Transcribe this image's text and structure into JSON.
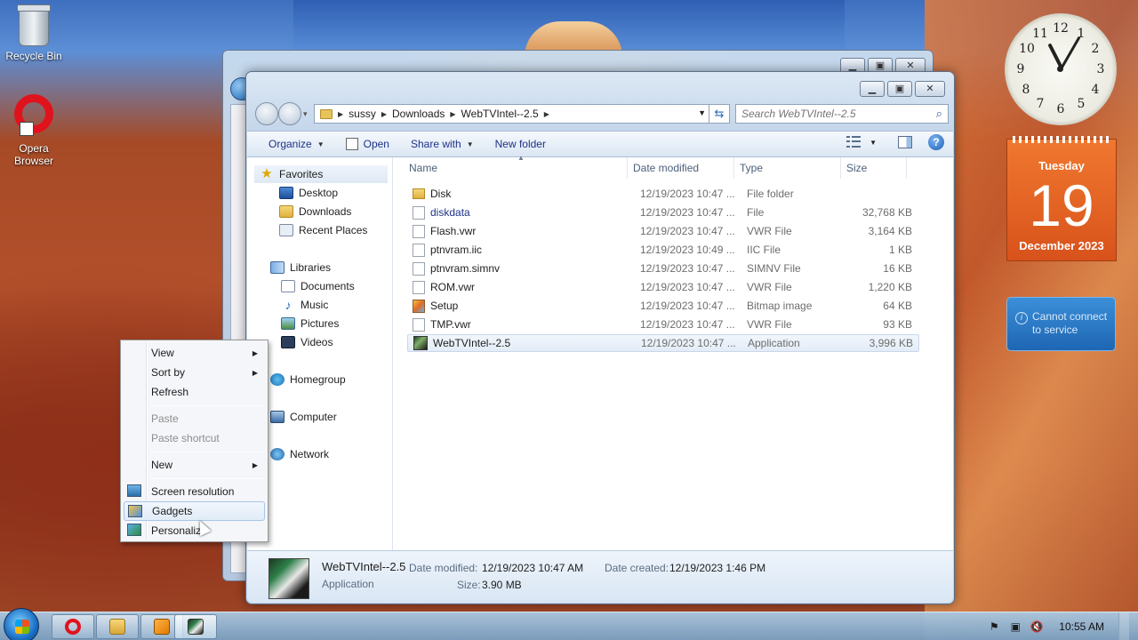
{
  "desktop": {
    "icons": [
      {
        "label": "Recycle Bin",
        "icon": "recycle-bin-icon"
      },
      {
        "label": "Opera\nBrowser",
        "icon": "opera-icon"
      }
    ]
  },
  "explorer": {
    "breadcrumb": [
      "sussy",
      "Downloads",
      "WebTVIntel--2.5"
    ],
    "search_placeholder": "Search WebTVIntel--2.5",
    "toolbar": {
      "organize": "Organize",
      "open": "Open",
      "share_with": "Share with",
      "new_folder": "New folder"
    },
    "nav": {
      "favorites": "Favorites",
      "desktop": "Desktop",
      "downloads": "Downloads",
      "recent_places": "Recent Places",
      "libraries": "Libraries",
      "documents": "Documents",
      "music": "Music",
      "pictures": "Pictures",
      "videos": "Videos",
      "homegroup": "Homegroup",
      "computer": "Computer",
      "network": "Network"
    },
    "columns": {
      "name": "Name",
      "date": "Date modified",
      "type": "Type",
      "size": "Size"
    },
    "files": [
      {
        "name": "Disk",
        "date": "12/19/2023 10:47 ...",
        "type": "File folder",
        "size": ""
      },
      {
        "name": "diskdata",
        "date": "12/19/2023 10:47 ...",
        "type": "File",
        "size": "32,768 KB"
      },
      {
        "name": "Flash.vwr",
        "date": "12/19/2023 10:47 ...",
        "type": "VWR File",
        "size": "3,164 KB"
      },
      {
        "name": "ptnvram.iic",
        "date": "12/19/2023 10:49 ...",
        "type": "IIC File",
        "size": "1 KB"
      },
      {
        "name": "ptnvram.simnv",
        "date": "12/19/2023 10:47 ...",
        "type": "SIMNV File",
        "size": "16 KB"
      },
      {
        "name": "ROM.vwr",
        "date": "12/19/2023 10:47 ...",
        "type": "VWR File",
        "size": "1,220 KB"
      },
      {
        "name": "Setup",
        "date": "12/19/2023 10:47 ...",
        "type": "Bitmap image",
        "size": "64 KB"
      },
      {
        "name": "TMP.vwr",
        "date": "12/19/2023 10:47 ...",
        "type": "VWR File",
        "size": "93 KB"
      },
      {
        "name": "WebTVIntel--2.5",
        "date": "12/19/2023 10:47 ...",
        "type": "Application",
        "size": "3,996 KB"
      }
    ],
    "details": {
      "name": "WebTVIntel--2.5",
      "type": "Application",
      "date_modified_label": "Date modified:",
      "date_modified": "12/19/2023 10:47 AM",
      "date_created_label": "Date created:",
      "date_created": "12/19/2023 1:46 PM",
      "size_label": "Size:",
      "size": "3.90 MB"
    }
  },
  "context_menu": {
    "view": "View",
    "sort_by": "Sort by",
    "refresh": "Refresh",
    "paste": "Paste",
    "paste_shortcut": "Paste shortcut",
    "new": "New",
    "screen_resolution": "Screen resolution",
    "gadgets": "Gadgets",
    "personalize": "Personalize"
  },
  "gadgets": {
    "clock_numbers": [
      "12",
      "1",
      "2",
      "3",
      "4",
      "5",
      "6",
      "7",
      "8",
      "9",
      "10",
      "11"
    ],
    "calendar": {
      "weekday": "Tuesday",
      "day": "19",
      "month_year": "December 2023"
    },
    "feed": "Cannot connect to service"
  },
  "taskbar": {
    "time": "10:55 AM"
  },
  "colors": {
    "calendar_orange": "#e2621f",
    "selection_blue": "#c9d7ea",
    "link_blue": "#1e3287"
  }
}
